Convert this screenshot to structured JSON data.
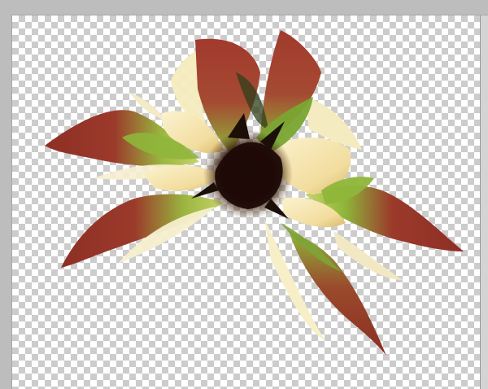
{
  "app": {
    "view": "transparent-canvas"
  },
  "canvas": {
    "background": "transparency-checkerboard",
    "checker_colors": [
      "#ffffff",
      "#cccccc"
    ]
  },
  "artwork": {
    "subject": "flower",
    "palette": {
      "petal_red": "#9b3a2b",
      "petal_green": "#8fb63a",
      "petal_cream": "#f4e8b8",
      "center_dark": "#2a120a"
    }
  }
}
